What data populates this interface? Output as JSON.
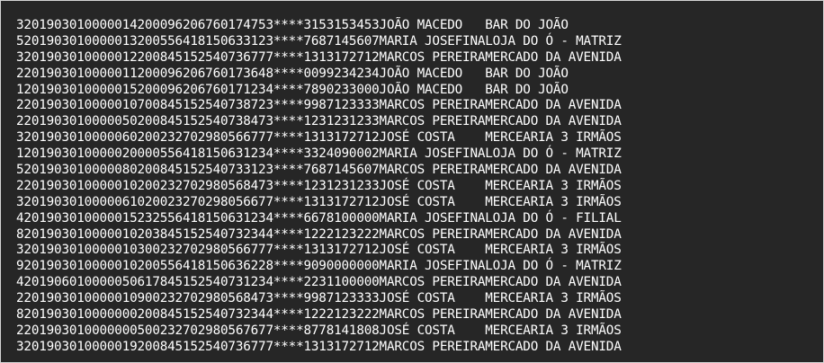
{
  "terminal": {
    "lines": [
      "3201903010000014200096206760174753****3153153453JOÃO MACEDO   BAR DO JOÃO",
      "5201903010000013200556418150633123****7687145607MARIA JOSEFINALOJA DO Ó - MATRIZ",
      "3201903010000012200845152540736777****1313172712MARCOS PEREIRAMERCADO DA AVENIDA",
      "2201903010000011200096206760173648****0099234234JOÃO MACEDO   BAR DO JOÃO",
      "1201903010000015200096206760171234****7890233000JOÃO MACEDO   BAR DO JOÃO",
      "2201903010000010700845152540738723****9987123333MARCOS PEREIRAMERCADO DA AVENIDA",
      "2201903010000050200845152540738473****1231231233MARCOS PEREIRAMERCADO DA AVENIDA",
      "3201903010000060200232702980566777****1313172712JOSÉ COSTA    MERCEARIA 3 IRMÃOS",
      "1201903010000020000556418150631234****3324090002MARIA JOSEFINALOJA DO Ó - MATRIZ",
      "5201903010000080200845152540733123****7687145607MARCOS PEREIRAMERCADO DA AVENIDA",
      "2201903010000010200232702980568473****1231231233JOSÉ COSTA    MERCEARIA 3 IRMÃOS",
      "3201903010000061020023270298056677****1313172712JOSÉ COSTA    MERCEARIA 3 IRMÃOS",
      "4201903010000015232556418150631234****6678100000MARIA JOSEFINALOJA DO Ó - FILIAL",
      "8201903010000010203845152540732344****1222123222MARCOS PEREIRAMERCADO DA AVENIDA",
      "3201903010000010300232702980566777****1313172712JOSÉ COSTA    MERCEARIA 3 IRMÃOS",
      "9201903010000010200556418150636228****9090000000MARIA JOSEFINALOJA DO Ó - MATRIZ",
      "4201906010000050617845152540731234****2231100000MARCOS PEREIRAMERCADO DA AVENIDA",
      "2201903010000010900232702980568473****9987123333JOSÉ COSTA    MERCEARIA 3 IRMÃOS",
      "8201903010000000200845152540732344****1222123222MARCOS PEREIRAMERCADO DA AVENIDA",
      "2201903010000000500232702980567677****8778141808JOSÉ COSTA    MERCEARIA 3 IRMÃOS",
      "3201903010000019200845152540736777****1313172712MARCOS PEREIRAMERCADO DA AVENIDA"
    ]
  }
}
